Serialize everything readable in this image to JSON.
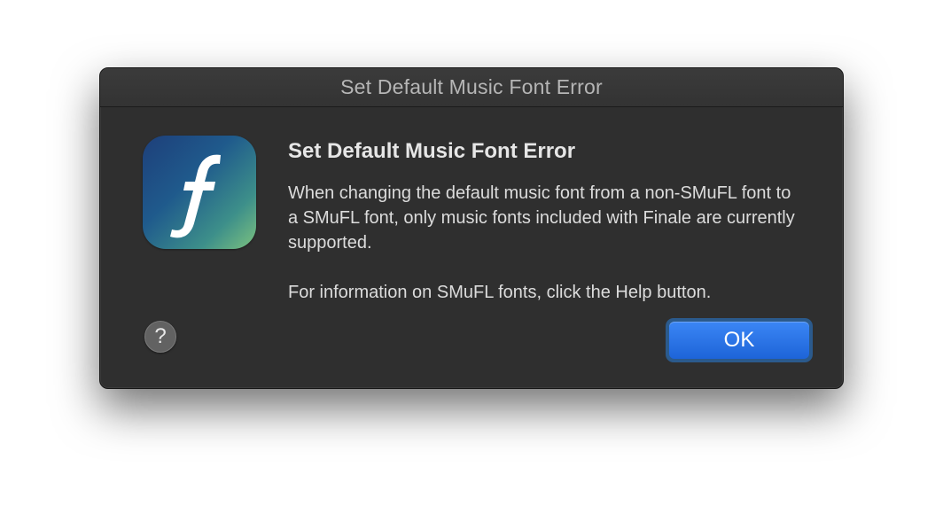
{
  "window": {
    "title": "Set Default Music Font Error"
  },
  "alert": {
    "heading": "Set Default Music Font Error",
    "message_paragraph_1": "When changing the default music font from a non-SMuFL font to a SMuFL font, only music fonts included with Finale are currently supported.",
    "message_paragraph_2": "For information on SMuFL fonts, click the Help button."
  },
  "buttons": {
    "help_label": "?",
    "ok_label": "OK"
  },
  "icons": {
    "app_icon": "finale-app-icon",
    "help_icon": "question-mark-icon"
  },
  "colors": {
    "dialog_background": "#2f2f2f",
    "accent_blue": "#2a74e8",
    "focus_ring": "#2b5a8c",
    "icon_gradient_start": "#1e3f7a",
    "icon_gradient_end": "#7cc27f"
  }
}
